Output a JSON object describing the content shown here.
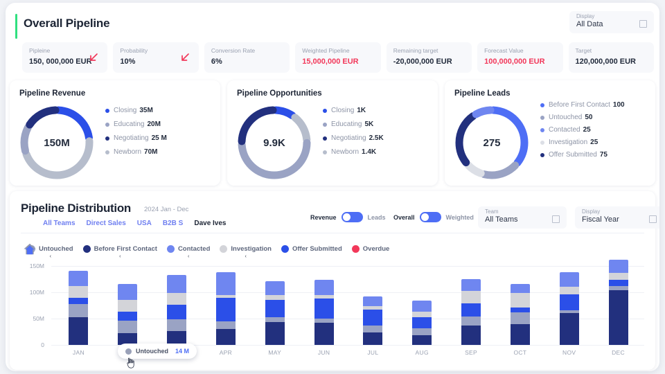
{
  "header": {
    "title": "Overall Pipeline",
    "accent_color": "#2fe07f",
    "display_select": {
      "label": "Display",
      "value": "All Data",
      "caret_icon": "chevron-down-icon"
    }
  },
  "kpis": [
    {
      "label": "Pipleine",
      "value": "150, 000,000 EUR",
      "color": "#222b3c",
      "arrow": "arrow-down-left-icon"
    },
    {
      "label": "Probability",
      "value": "10%",
      "color": "#222b3c",
      "arrow": "arrow-down-left-icon"
    },
    {
      "label": "Conversion Rate",
      "value": "6%",
      "color": "#222b3c",
      "arrow": ""
    },
    {
      "label": "Weighted Pipeline",
      "value": "15,000,000 EUR",
      "color": "#f2385a",
      "arrow": ""
    },
    {
      "label": "Remaining target",
      "value": "-20,000,000 EUR",
      "color": "#222b3c",
      "arrow": ""
    },
    {
      "label": "Forecast Value",
      "value": "100,000,000 EUR",
      "color": "#f2385a",
      "arrow": ""
    },
    {
      "label": "Target",
      "value": "120,000,000 EUR",
      "color": "#222b3c",
      "arrow": ""
    }
  ],
  "donut_cards": [
    {
      "title": "Pipeline Revenue",
      "center": "150M",
      "legend": [
        {
          "label": "Closing",
          "value": "35M",
          "color": "#2b4fe8"
        },
        {
          "label": "Educating",
          "value": "20M",
          "color": "#9aa3c4"
        },
        {
          "label": "Negotiating",
          "value": "25 M",
          "color": "#22307e"
        },
        {
          "label": "Newborn",
          "value": "70M",
          "color": "#b6bdcc"
        }
      ]
    },
    {
      "title": "Pipeline Opportunities",
      "center": "9.9K",
      "legend": [
        {
          "label": "Closing",
          "value": "1K",
          "color": "#2b4fe8"
        },
        {
          "label": "Educating",
          "value": "5K",
          "color": "#9aa3c4"
        },
        {
          "label": "Negotiating",
          "value": "2.5K",
          "color": "#22307e"
        },
        {
          "label": "Newborn",
          "value": "1.4K",
          "color": "#b6bdcc"
        }
      ]
    },
    {
      "title": "Pipeline Leads",
      "center": "275",
      "legend": [
        {
          "label": "Before First Contact",
          "value": "100",
          "color": "#4e6ef5"
        },
        {
          "label": "Untouched",
          "value": "50",
          "color": "#9aa3c4"
        },
        {
          "label": "Contacted",
          "value": "25",
          "color": "#6f86f0"
        },
        {
          "label": "Investigation",
          "value": "25",
          "color": "#dcdfe6"
        },
        {
          "label": "Offer Submitted",
          "value": "75",
          "color": "#22307e"
        }
      ]
    }
  ],
  "distribution": {
    "title": "Pipeline Distribution",
    "period": "2024 Jan - Dec",
    "tabs": [
      {
        "label": "All Teams",
        "active": false
      },
      {
        "label": "Direct Sales",
        "active": false
      },
      {
        "label": "USA",
        "active": false
      },
      {
        "label": "B2B S",
        "active": false
      },
      {
        "label": "Dave Ives",
        "active": true
      }
    ],
    "toggles": [
      {
        "left_label": "Revenue",
        "right_label": "Leads",
        "state": "left"
      },
      {
        "left_label": "Overall",
        "right_label": "Weighted",
        "state": "left"
      }
    ],
    "selects": [
      {
        "label": "Team",
        "value": "All Teams",
        "caret_icon": "chevron-down-icon"
      },
      {
        "label": "Display",
        "value": "Fiscal Year",
        "caret_icon": "chevron-down-icon"
      }
    ],
    "tooltip": {
      "label": "Untouched",
      "value": "14 M",
      "dot_color": "#9aa1b8"
    },
    "cursor_icons": [
      "home-cursor-icon",
      "pointing-hand-cursor-icon"
    ]
  },
  "chart_data": {
    "type": "bar",
    "title": "Pipeline Distribution",
    "stacked": true,
    "xlabel": "",
    "ylabel": "",
    "ylim": [
      0,
      160
    ],
    "yticks": [
      "0",
      "50M",
      "100M",
      "150M"
    ],
    "ytick_values": [
      0,
      50,
      100,
      150
    ],
    "grid": true,
    "legend_position": "top",
    "categories": [
      "JAN",
      "FEB",
      "MAR",
      "APR",
      "MAY",
      "JUN",
      "JUL",
      "AUG",
      "SEP",
      "OCT",
      "NOV",
      "DEC"
    ],
    "series": [
      {
        "name": "Untouched",
        "color": "#22307e",
        "values": [
          52,
          22,
          26,
          30,
          43,
          42,
          23,
          18,
          37,
          40,
          60,
          103
        ]
      },
      {
        "name": "Before First Contact",
        "color": "#22307e",
        "values": [
          0,
          0,
          0,
          0,
          0,
          0,
          0,
          0,
          0,
          0,
          0,
          0
        ]
      },
      {
        "name": "Contacted",
        "color": "#9aa3c4",
        "values": [
          25,
          24,
          22,
          14,
          10,
          8,
          14,
          13,
          17,
          22,
          6,
          8
        ]
      },
      {
        "name": "Investigation",
        "color": "#2b4fe8",
        "values": [
          12,
          17,
          28,
          45,
          32,
          38,
          30,
          21,
          25,
          9,
          30,
          12
        ]
      },
      {
        "name": "Offer Submitted",
        "color": "#d3d4d9",
        "values": [
          22,
          22,
          22,
          6,
          10,
          7,
          6,
          11,
          23,
          27,
          14,
          14
        ]
      },
      {
        "name": "Overdue",
        "color": "#6f86f0",
        "values": [
          30,
          31,
          35,
          43,
          26,
          28,
          19,
          21,
          23,
          17,
          28,
          25
        ]
      }
    ],
    "legend": [
      {
        "label": "Untouched",
        "color": "#9aa3c4"
      },
      {
        "label": "Before First Contact",
        "color": "#22307e"
      },
      {
        "label": "Contacted",
        "color": "#6f86f0"
      },
      {
        "label": "Investigation",
        "color": "#d3d4d9"
      },
      {
        "label": "Offer Submitted",
        "color": "#2b4fe8"
      },
      {
        "label": "Overdue",
        "color": "#f2385a"
      }
    ]
  }
}
